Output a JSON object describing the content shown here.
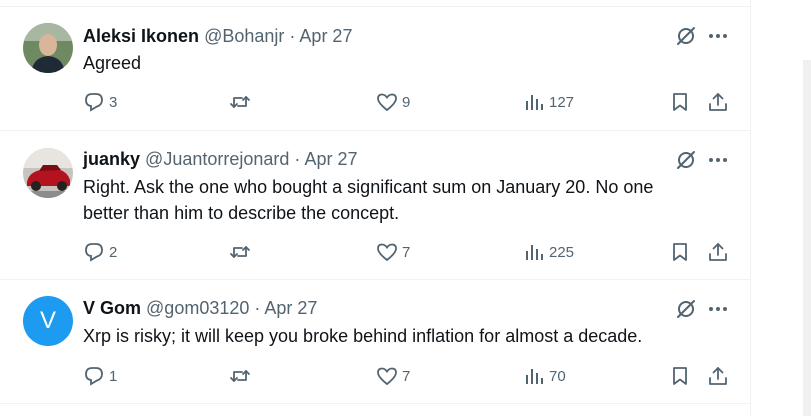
{
  "tweets": [
    {
      "name": "Aleksi Ikonen",
      "handle": "@Bohanjr",
      "dot": "·",
      "date": "Apr 27",
      "text": "Agreed",
      "avatar_icon": "photo-avatar-person",
      "replies": "3",
      "retweets": "",
      "likes": "9",
      "views": "127"
    },
    {
      "name": "juanky",
      "handle": "@Juantorrejonard",
      "dot": "·",
      "date": "Apr 27",
      "text": "Right. Ask the one who bought a significant sum on January 20. No one better than him to describe the concept.",
      "avatar_icon": "photo-avatar-red-car",
      "replies": "2",
      "retweets": "",
      "likes": "7",
      "views": "225"
    },
    {
      "name": "V Gom",
      "handle": "@gom03120",
      "dot": "·",
      "date": "Apr 27",
      "text": "Xrp is risky; it will keep you broke behind inflation for almost a decade.",
      "avatar_letter": "V",
      "avatar_color": "#1d9bf0",
      "replies": "1",
      "retweets": "",
      "likes": "7",
      "views": "70"
    }
  ],
  "colors": {
    "text": "#0f1419",
    "muted": "#536471",
    "border": "#eff3f4",
    "accent": "#1d9bf0"
  }
}
